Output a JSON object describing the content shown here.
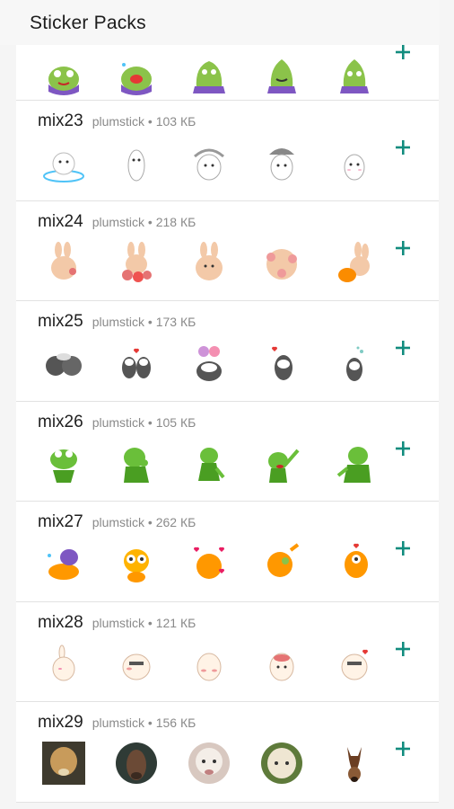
{
  "header": {
    "title": "Sticker Packs"
  },
  "colors": {
    "accent": "#128c7e",
    "background": "#f5f5f5",
    "card": "#ffffff"
  },
  "packs": [
    {
      "name": "",
      "author": "",
      "size": "",
      "theme": "frog-purple",
      "stickers": [
        "frog-sticker",
        "frog-sticker",
        "frog-sticker",
        "frog-sticker",
        "frog-sticker"
      ],
      "add_icon": "plus-icon"
    },
    {
      "name": "mix23",
      "author": "plumstick",
      "size": "103 КБ",
      "theme": "bunny-white",
      "add_icon": "plus-icon"
    },
    {
      "name": "mix24",
      "author": "plumstick",
      "size": "218 КБ",
      "theme": "bunny-peach",
      "add_icon": "plus-icon"
    },
    {
      "name": "mix25",
      "author": "plumstick",
      "size": "173 КБ",
      "theme": "raccoon",
      "add_icon": "plus-icon"
    },
    {
      "name": "mix26",
      "author": "plumstick",
      "size": "105 КБ",
      "theme": "kermit",
      "add_icon": "plus-icon"
    },
    {
      "name": "mix27",
      "author": "plumstick",
      "size": "262 КБ",
      "theme": "orange-cat",
      "add_icon": "plus-icon"
    },
    {
      "name": "mix28",
      "author": "plumstick",
      "size": "121 КБ",
      "theme": "bunny-cream",
      "add_icon": "plus-icon"
    },
    {
      "name": "mix29",
      "author": "plumstick",
      "size": "156 КБ",
      "theme": "alpaca-photo",
      "add_icon": "plus-icon"
    }
  ]
}
